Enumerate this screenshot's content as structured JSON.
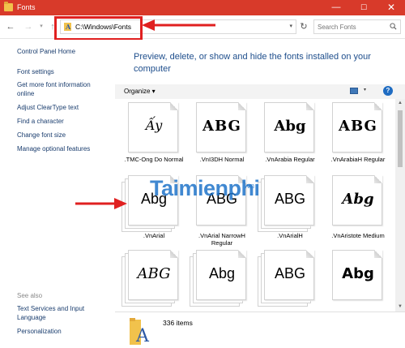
{
  "window": {
    "title": "Fonts",
    "minimize": "—",
    "maximize": "☐",
    "close": "✕"
  },
  "address": {
    "path": "C:\\Windows\\Fonts"
  },
  "search": {
    "placeholder": "Search Fonts"
  },
  "left_pane": {
    "control_panel_home": "Control Panel Home",
    "links": [
      {
        "label": "Font settings"
      },
      {
        "label": "Get more font information online"
      },
      {
        "label": "Adjust ClearType text"
      },
      {
        "label": "Find a character"
      },
      {
        "label": "Change font size"
      },
      {
        "label": "Manage optional features"
      }
    ],
    "see_also": "See also",
    "see_also_links": [
      {
        "label": "Text Services and Input Language"
      },
      {
        "label": "Personalization"
      }
    ]
  },
  "main": {
    "heading": "Preview, delete, or show and hide the fonts installed on your computer",
    "toolbar": {
      "organize": "Organize ▾"
    }
  },
  "fonts": [
    {
      "name": ".TMC-Ong Do Normal",
      "sample": "Ấy",
      "stack": false
    },
    {
      "name": ".VnI3DH Normal",
      "sample": "ABG",
      "stack": false
    },
    {
      "name": ".VnArabia Regular",
      "sample": "Abg",
      "stack": false
    },
    {
      "name": ".VnArabiaH Regular",
      "sample": "ABG",
      "stack": false
    },
    {
      "name": ".VnArial",
      "sample": "Abg",
      "stack": true
    },
    {
      "name": ".VnArial NarrowH Regular",
      "sample": "ABG",
      "stack": false
    },
    {
      "name": ".VnArialH",
      "sample": "ABG",
      "stack": true
    },
    {
      "name": ".VnAristote Medium",
      "sample": "Abg",
      "stack": false
    },
    {
      "name": "",
      "sample": "ABG",
      "stack": true
    },
    {
      "name": "",
      "sample": "Abg",
      "stack": true
    },
    {
      "name": "",
      "sample": "ABG",
      "stack": true
    },
    {
      "name": "",
      "sample": "Abg",
      "stack": false
    }
  ],
  "details": {
    "item_count": "336 items"
  },
  "watermark": {
    "main": "Taimienphi",
    "suffix": ".vn"
  }
}
